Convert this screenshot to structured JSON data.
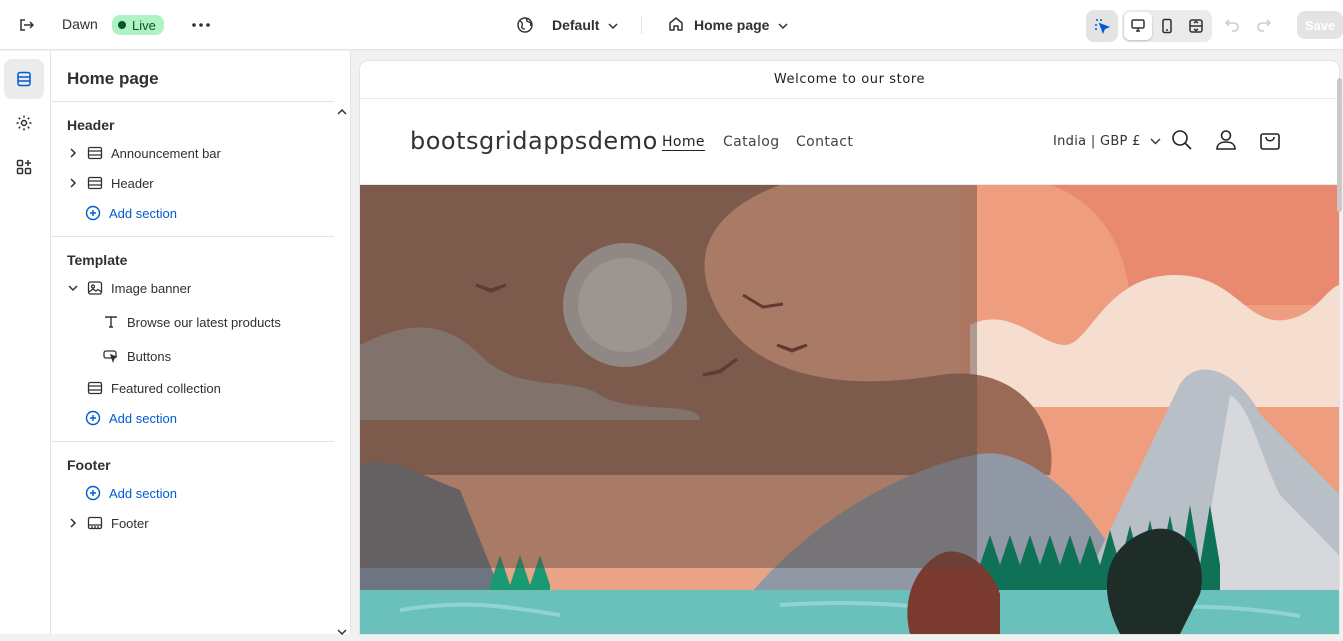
{
  "topbar": {
    "theme_name": "Dawn",
    "status_badge": "Live",
    "preset_label": "Default",
    "page_selector": "Home page",
    "save_label": "Save"
  },
  "sidebar": {
    "title": "Home page",
    "groups": [
      {
        "title": "Header",
        "items": [
          {
            "label": "Announcement bar",
            "icon": "section-icon"
          },
          {
            "label": "Header",
            "icon": "section-icon"
          }
        ],
        "add_label": "Add section"
      },
      {
        "title": "Template",
        "items": [
          {
            "label": "Image banner",
            "icon": "image-icon",
            "expanded": true,
            "blocks": [
              {
                "label": "Browse our latest products",
                "icon": "text-icon"
              },
              {
                "label": "Buttons",
                "icon": "button-icon"
              }
            ]
          },
          {
            "label": "Featured collection",
            "icon": "section-icon"
          }
        ],
        "add_label": "Add section"
      },
      {
        "title": "Footer",
        "add_label": "Add section",
        "items": [
          {
            "label": "Footer",
            "icon": "footer-section-icon"
          }
        ]
      }
    ]
  },
  "preview": {
    "announcement": "Welcome to our store",
    "logo": "bootsgridappsdemo",
    "nav": [
      "Home",
      "Catalog",
      "Contact"
    ],
    "country": "India | GBP £"
  },
  "colors": {
    "accent": "#005bd3",
    "live_badge_bg": "#aff2c4",
    "live_badge_fg": "#0c5132"
  }
}
